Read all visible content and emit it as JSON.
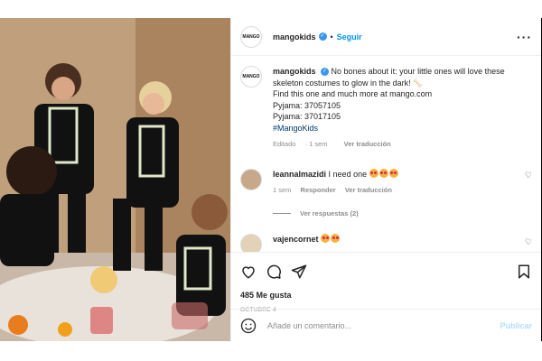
{
  "post": {
    "username": "mangokids",
    "avatar_text": "MANGO",
    "follow_label": "Seguir",
    "caption": "No bones about it: your little ones will love these skeleton costumes to glow in the dark! 🦴",
    "caption_line2": "Find this one and much more at mango.com",
    "caption_line3": "Pyjama: 37057105",
    "caption_line4": "Pyjama: 37017105",
    "hashtag": "#MangoKids",
    "edited": "Editado",
    "time": "1 sem",
    "see_translation": "Ver traducción"
  },
  "comments": [
    {
      "username": "leannalmazidi",
      "text": "I need one",
      "time": "1 sem",
      "reply": "Responder",
      "see_translation": "Ver traducción",
      "view_replies": "Ver respuestas (2)"
    },
    {
      "username": "vajencornet",
      "text": ""
    }
  ],
  "actions": {
    "likes": "485 Me gusta",
    "date": "OCTUBRE 4"
  },
  "add_comment": {
    "placeholder": "Añade un comentario...",
    "publish": "Publicar"
  },
  "colors": {
    "accent": "#0095f6",
    "verified": "#3897f0",
    "publish_disabled": "#b2dffc"
  }
}
